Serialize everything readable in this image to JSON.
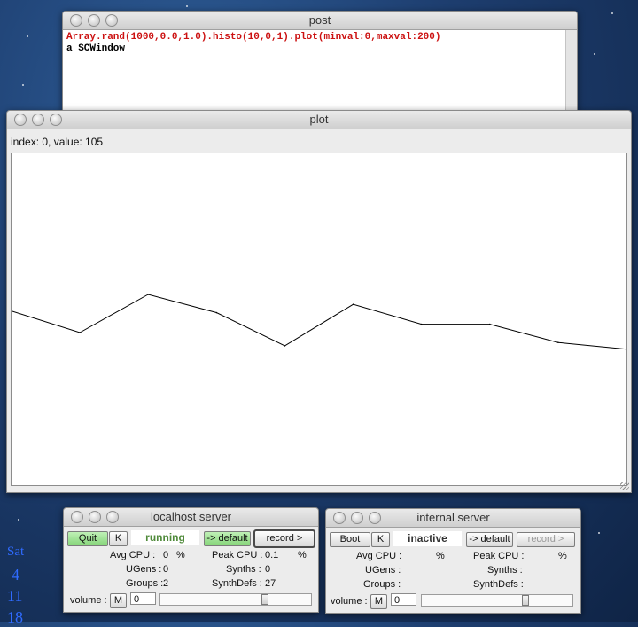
{
  "post_window": {
    "title": "post",
    "lines": [
      {
        "text": "Array.rand(1000,0.0,1.0).histo(10,0,1).plot(minval:0,maxval:200)",
        "color": "#cc1111"
      },
      {
        "text": "a SCWindow",
        "color": "#000000"
      }
    ]
  },
  "plot_window": {
    "title": "plot",
    "index_label": "index: 0, value: 105",
    "chart_data": {
      "type": "line",
      "x": [
        0,
        1,
        2,
        3,
        4,
        5,
        6,
        7,
        8,
        9
      ],
      "values": [
        105,
        92,
        115,
        104,
        84,
        109,
        97,
        97,
        86,
        82
      ],
      "ylim": [
        0,
        200
      ],
      "grid": false,
      "line_color": "#000000"
    }
  },
  "localhost_server": {
    "title": "localhost server",
    "quit_label": "Quit",
    "k_label": "K",
    "status": "running",
    "status_color": "#4f8a3a",
    "default_label": "-> default",
    "record_label": "record >",
    "avg_cpu_label": "Avg CPU :",
    "avg_cpu_value": "0",
    "pct1": "%",
    "peak_cpu_label": "Peak CPU :",
    "peak_cpu_value": "0.1",
    "pct2": "%",
    "ugens_label": "UGens :",
    "ugens_value": "0",
    "synths_label": "Synths :",
    "synths_value": "0",
    "groups_label": "Groups :",
    "groups_value": "2",
    "synthdefs_label": "SynthDefs :",
    "synthdefs_value": "27",
    "volume_label": "volume :",
    "mute_label": "M",
    "volume_value": "0"
  },
  "internal_server": {
    "title": "internal server",
    "boot_label": "Boot",
    "k_label": "K",
    "status": "inactive",
    "status_color": "#333333",
    "default_label": "-> default",
    "record_label": "record >",
    "avg_cpu_label": "Avg CPU :",
    "pct1": "%",
    "peak_cpu_label": "Peak CPU :",
    "pct2": "%",
    "ugens_label": "UGens :",
    "synths_label": "Synths :",
    "groups_label": "Groups :",
    "synthdefs_label": "SynthDefs :",
    "volume_label": "volume :",
    "mute_label": "M",
    "volume_value": "0"
  },
  "calendar_fragment": {
    "day": "Sat",
    "dates": [
      "4",
      "11",
      "18"
    ],
    "color": "#2f6bff"
  }
}
